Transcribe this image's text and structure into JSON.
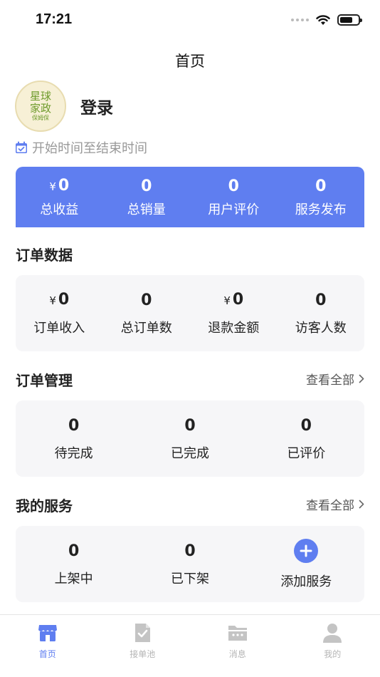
{
  "status_bar": {
    "time": "17:21"
  },
  "nav": {
    "title": "首页"
  },
  "profile": {
    "avatar_line1": "星球",
    "avatar_line2": "家政",
    "avatar_line3": "保姆保",
    "login_label": "登录"
  },
  "date_range": {
    "label": "开始时间至结束时间"
  },
  "summary": {
    "items": [
      {
        "currency": "¥",
        "value": "0",
        "label": "总收益"
      },
      {
        "value": "0",
        "label": "总销量"
      },
      {
        "value": "0",
        "label": "用户评价"
      },
      {
        "value": "0",
        "label": "服务发布"
      }
    ]
  },
  "order_data": {
    "title": "订单数据",
    "items": [
      {
        "currency": "¥",
        "value": "0",
        "label": "订单收入"
      },
      {
        "value": "0",
        "label": "总订单数"
      },
      {
        "currency": "¥",
        "value": "0",
        "label": "退款金额"
      },
      {
        "value": "0",
        "label": "访客人数"
      }
    ]
  },
  "order_manage": {
    "title": "订单管理",
    "view_all": "查看全部",
    "items": [
      {
        "value": "0",
        "label": "待完成"
      },
      {
        "value": "0",
        "label": "已完成"
      },
      {
        "value": "0",
        "label": "已评价"
      }
    ]
  },
  "my_services": {
    "title": "我的服务",
    "view_all": "查看全部",
    "items": [
      {
        "value": "0",
        "label": "上架中"
      },
      {
        "value": "0",
        "label": "已下架"
      }
    ],
    "add_label": "添加服务"
  },
  "tabbar": {
    "tabs": [
      {
        "label": "首页",
        "icon": "store-icon",
        "active": true
      },
      {
        "label": "接单池",
        "icon": "clipboard-check-icon"
      },
      {
        "label": "消息",
        "icon": "message-folder-icon"
      },
      {
        "label": "我的",
        "icon": "user-icon"
      }
    ]
  },
  "colors": {
    "accent": "#5f7ef0",
    "inactive_tab": "#b5b5b5",
    "card_bg": "#f6f6f8"
  }
}
